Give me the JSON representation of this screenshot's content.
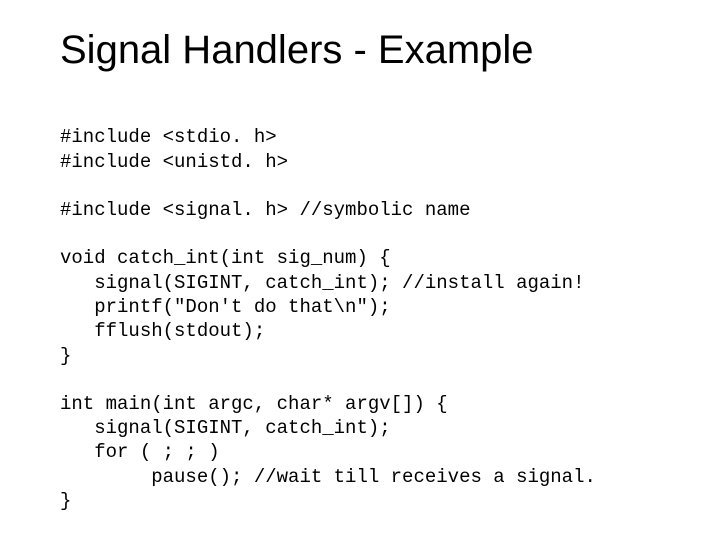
{
  "title": "Signal Handlers - Example",
  "code": {
    "l1": "#include <stdio. h>",
    "l2": "#include <unistd. h>",
    "l3": "#include <signal. h> //symbolic name",
    "l4": "void catch_int(int sig_num) {",
    "l5": "   signal(SIGINT, catch_int); //install again!",
    "l6": "   printf(\"Don't do that\\n\");",
    "l7": "   fflush(stdout);",
    "l8": "}",
    "l9": "int main(int argc, char* argv[]) {",
    "l10": "   signal(SIGINT, catch_int);",
    "l11": "   for ( ; ; )",
    "l12": "        pause(); //wait till receives a signal.",
    "l13": "}"
  }
}
